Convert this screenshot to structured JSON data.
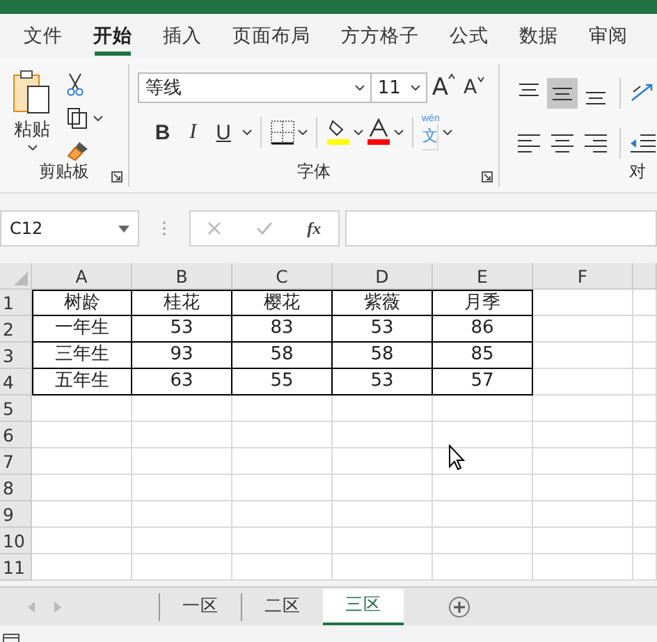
{
  "ribbon_tabs": [
    {
      "label": "文件",
      "selected": false
    },
    {
      "label": "开始",
      "selected": true
    },
    {
      "label": "插入",
      "selected": false
    },
    {
      "label": "页面布局",
      "selected": false
    },
    {
      "label": "方方格子",
      "selected": false
    },
    {
      "label": "公式",
      "selected": false
    },
    {
      "label": "数据",
      "selected": false
    },
    {
      "label": "审阅",
      "selected": false
    }
  ],
  "clipboard": {
    "paste_label": "粘贴",
    "group_label": "剪贴板"
  },
  "font": {
    "font_name": "等线",
    "font_size": "11",
    "grow": "A",
    "shrink": "A",
    "styles": [
      {
        "label": "B",
        "kind": "bold"
      },
      {
        "label": "I",
        "kind": "italic"
      },
      {
        "label": "U",
        "kind": "underline"
      }
    ],
    "phonetic_top": "wén",
    "phonetic_char": "文",
    "group_label": "字体"
  },
  "alignment": {
    "group_label": "对",
    "vertical": [
      {
        "kind": "top",
        "selected": false
      },
      {
        "kind": "middle",
        "selected": true
      },
      {
        "kind": "bottom",
        "selected": false
      }
    ]
  },
  "formula_bar": {
    "name_box": "C12",
    "fx": "fx"
  },
  "columns": [
    "A",
    "B",
    "C",
    "D",
    "E",
    "F"
  ],
  "rows": [
    {
      "number": "1",
      "cells": [
        "树龄",
        "桂花",
        "樱花",
        "紫薇",
        "月季"
      ]
    },
    {
      "number": "2",
      "cells": [
        "一年生",
        "53",
        "83",
        "53",
        "86"
      ]
    },
    {
      "number": "3",
      "cells": [
        "三年生",
        "93",
        "58",
        "58",
        "85"
      ]
    },
    {
      "number": "4",
      "cells": [
        "五年生",
        "63",
        "55",
        "53",
        "57"
      ]
    },
    {
      "number": "5",
      "cells": []
    },
    {
      "number": "6",
      "cells": []
    },
    {
      "number": "7",
      "cells": []
    },
    {
      "number": "8",
      "cells": []
    },
    {
      "number": "9",
      "cells": []
    },
    {
      "number": "10",
      "cells": []
    },
    {
      "number": "11",
      "cells": []
    }
  ],
  "sheets": [
    {
      "label": "一区",
      "selected": false
    },
    {
      "label": "二区",
      "selected": false
    },
    {
      "label": "三区",
      "selected": true
    }
  ]
}
